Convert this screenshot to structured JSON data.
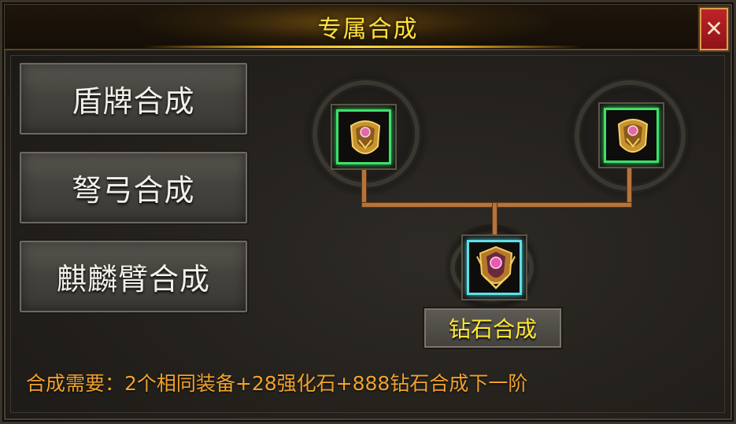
{
  "window": {
    "title": "专属合成",
    "close_icon": "close-icon"
  },
  "sidebar": {
    "items": [
      {
        "label": "盾牌合成"
      },
      {
        "label": "弩弓合成"
      },
      {
        "label": "麒麟臂合成"
      }
    ]
  },
  "synthesis_tree": {
    "input_slots": [
      {
        "icon": "golden-armlet-icon",
        "frame_color": "#3ee06a"
      },
      {
        "icon": "golden-armlet-icon",
        "frame_color": "#3ee06a"
      }
    ],
    "output_slot": {
      "icon": "jeweled-armlet-icon",
      "frame_color": "#5fe0e6"
    },
    "action_button_label": "钻石合成"
  },
  "requirement": {
    "text": "合成需要：2个相同装备+28强化石+888钻石合成下一阶"
  },
  "colors": {
    "title": "#ffe23a",
    "requirement": "#f0a22e",
    "action_label": "#ffe836",
    "close_button": "#c0242a"
  }
}
